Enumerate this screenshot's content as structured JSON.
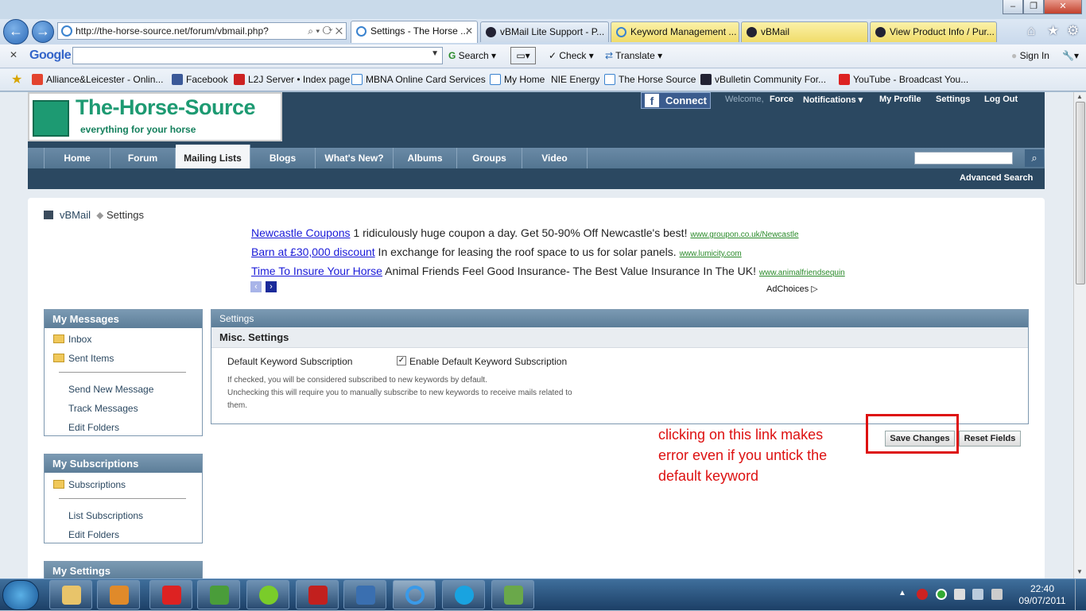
{
  "browser": {
    "address": "http://the-horse-source.net/forum/vbmail.php?",
    "tabs": [
      {
        "label": "Settings - The Horse ..."
      },
      {
        "label": "vBMail Lite Support - P..."
      },
      {
        "label": "Keyword Management ..."
      },
      {
        "label": "vBMail"
      },
      {
        "label": "View Product Info / Pur..."
      }
    ],
    "google": {
      "logo": "Google",
      "search_label": "Search",
      "check_label": "Check",
      "translate_label": "Translate",
      "signin_label": "Sign In"
    },
    "favorites": [
      "Alliance&Leicester - Onlin...",
      "Facebook",
      "L2J Server • Index page",
      "MBNA Online Card Services",
      "My Home",
      "NIE Energy",
      "The Horse Source",
      "vBulletin Community For...",
      "YouTube - Broadcast You..."
    ]
  },
  "site": {
    "logo_name": "The-Horse-Source",
    "logo_tagline": "everything for your horse",
    "connect_label": "Connect",
    "welcome": "Welcome,",
    "username": "Force",
    "top_links": [
      "Notifications ▾",
      "My Profile",
      "Settings",
      "Log Out"
    ],
    "nav": [
      "Home",
      "Forum",
      "Mailing Lists",
      "Blogs",
      "What's New?",
      "Albums",
      "Groups",
      "Video"
    ],
    "advanced_search": "Advanced Search"
  },
  "breadcrumb": {
    "link": "vBMail",
    "current": "Settings"
  },
  "ads": [
    {
      "headline": "Newcastle Coupons",
      "text": " 1 ridiculously huge coupon a day. Get 50-90% Off Newcastle's best! ",
      "url": "www.groupon.co.uk/Newcastle"
    },
    {
      "headline": "Barn at £30,000 discount",
      "text": " In exchange for leasing the roof space to us for solar panels. ",
      "url": "www.lumicity.com"
    },
    {
      "headline": "Time To Insure Your Horse",
      "text": " Animal Friends Feel Good Insurance- The Best Value Insurance In The UK! ",
      "url": "www.animalfriendsequin"
    }
  ],
  "adchoices": "AdChoices ▷",
  "sidebar": {
    "messages": {
      "title": "My Messages",
      "folders": [
        "Inbox",
        "Sent Items"
      ],
      "links": [
        "Send New Message",
        "Track Messages",
        "Edit Folders"
      ]
    },
    "subscriptions": {
      "title": "My Subscriptions",
      "folders": [
        "Subscriptions"
      ],
      "links": [
        "List Subscriptions",
        "Edit Folders"
      ]
    },
    "settings": {
      "title": "My Settings"
    }
  },
  "settings": {
    "title": "Settings",
    "section": "Misc. Settings",
    "option_label": "Default Keyword Subscription",
    "checkbox_label": "Enable Default Keyword Subscription",
    "checked": true,
    "help_line1": "If checked, you will be considered subscribed to new keywords by default.",
    "help_line2": "Unchecking this will require you to manually subscribe to new keywords to receive mails related to",
    "help_line3": "them.",
    "save_label": "Save Changes",
    "reset_label": "Reset Fields"
  },
  "annotation": "clicking on this link makes error even if you untick the default keyword",
  "taskbar": {
    "time": "22:40",
    "date": "09/07/2011"
  }
}
